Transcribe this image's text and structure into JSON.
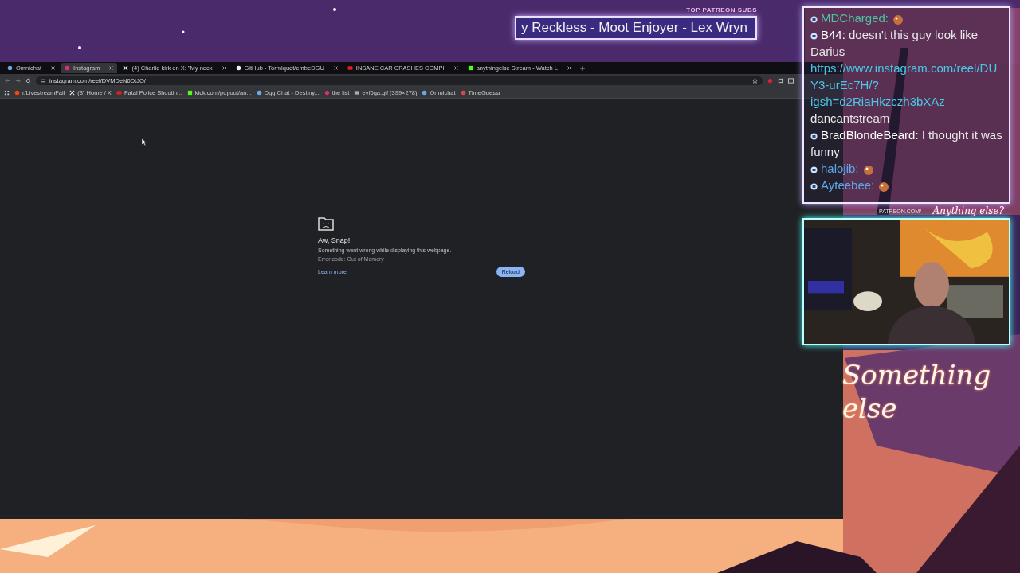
{
  "banner": {
    "heading": "TOP PATREON SUBS",
    "ticker": "y Reckless - Moot Enjoyer - Lex Wryn"
  },
  "browser": {
    "tabs": [
      {
        "title": "Omnichat",
        "kind": "omnichat",
        "selected": false
      },
      {
        "title": "Instagram",
        "kind": "instagram",
        "selected": true
      },
      {
        "title": "(4) Charlie kirk on X: \"My neck",
        "kind": "x",
        "selected": false
      },
      {
        "title": "GitHub - Tormiquet/embeDGU",
        "kind": "github",
        "selected": false
      },
      {
        "title": "INSANE CAR CRASHES COMPI",
        "kind": "youtube",
        "selected": false
      },
      {
        "title": "anythingelse Stream - Watch L",
        "kind": "kick",
        "selected": false
      }
    ],
    "address": "instagram.com/reel/DVMDeN0DtJO/",
    "bookmarks": [
      {
        "title": "r/LivestreamFail",
        "kind": "reddit"
      },
      {
        "title": "(3) Home / X",
        "kind": "x"
      },
      {
        "title": "Fatal Police Shootin...",
        "kind": "youtube"
      },
      {
        "title": "kick.com/popout/an...",
        "kind": "kick"
      },
      {
        "title": "Dgg Chat - Destiny...",
        "kind": "omnichat"
      },
      {
        "title": "the list",
        "kind": "dot"
      },
      {
        "title": "evf6ga.gif (399×278)"
      },
      {
        "title": "Omnichat",
        "kind": "omnichat"
      },
      {
        "title": "TimeGuessr",
        "kind": "globe"
      }
    ],
    "error": {
      "title": "Aw, Snap!",
      "message": "Something went wrong while displaying this webpage.",
      "code": "Error code: Out of Memory",
      "link": "Learn more",
      "button": "Reload"
    }
  },
  "chat": [
    {
      "user": "MDCharged:",
      "color": "#4fc3a0",
      "parts": [
        {
          "kind": "emote"
        }
      ]
    },
    {
      "user": "B44:",
      "color": "#ffffff",
      "parts": [
        {
          "kind": "text",
          "text": "doesn't this guy look like Darius"
        },
        {
          "kind": "link",
          "text": "https://www.instagram.com/reel/DUY3-urEc7H/?igsh=d2RiaHkzczh3bXAz"
        },
        {
          "kind": "text",
          "text": "dancantstream"
        }
      ]
    },
    {
      "user": "BradBlondeBeard:",
      "color": "#ffffff",
      "parts": [
        {
          "kind": "text",
          "text": "I thought it was funny"
        }
      ]
    },
    {
      "user": "halojib:",
      "color": "#5aa8e8",
      "parts": [
        {
          "kind": "emote"
        }
      ]
    },
    {
      "user": "Ayteebee:",
      "color": "#5aa8e8",
      "parts": [
        {
          "kind": "emote"
        }
      ]
    }
  ],
  "webcam": {
    "site": "PATREON.COM/",
    "logo": "Anything else?"
  },
  "logo": "Something else"
}
